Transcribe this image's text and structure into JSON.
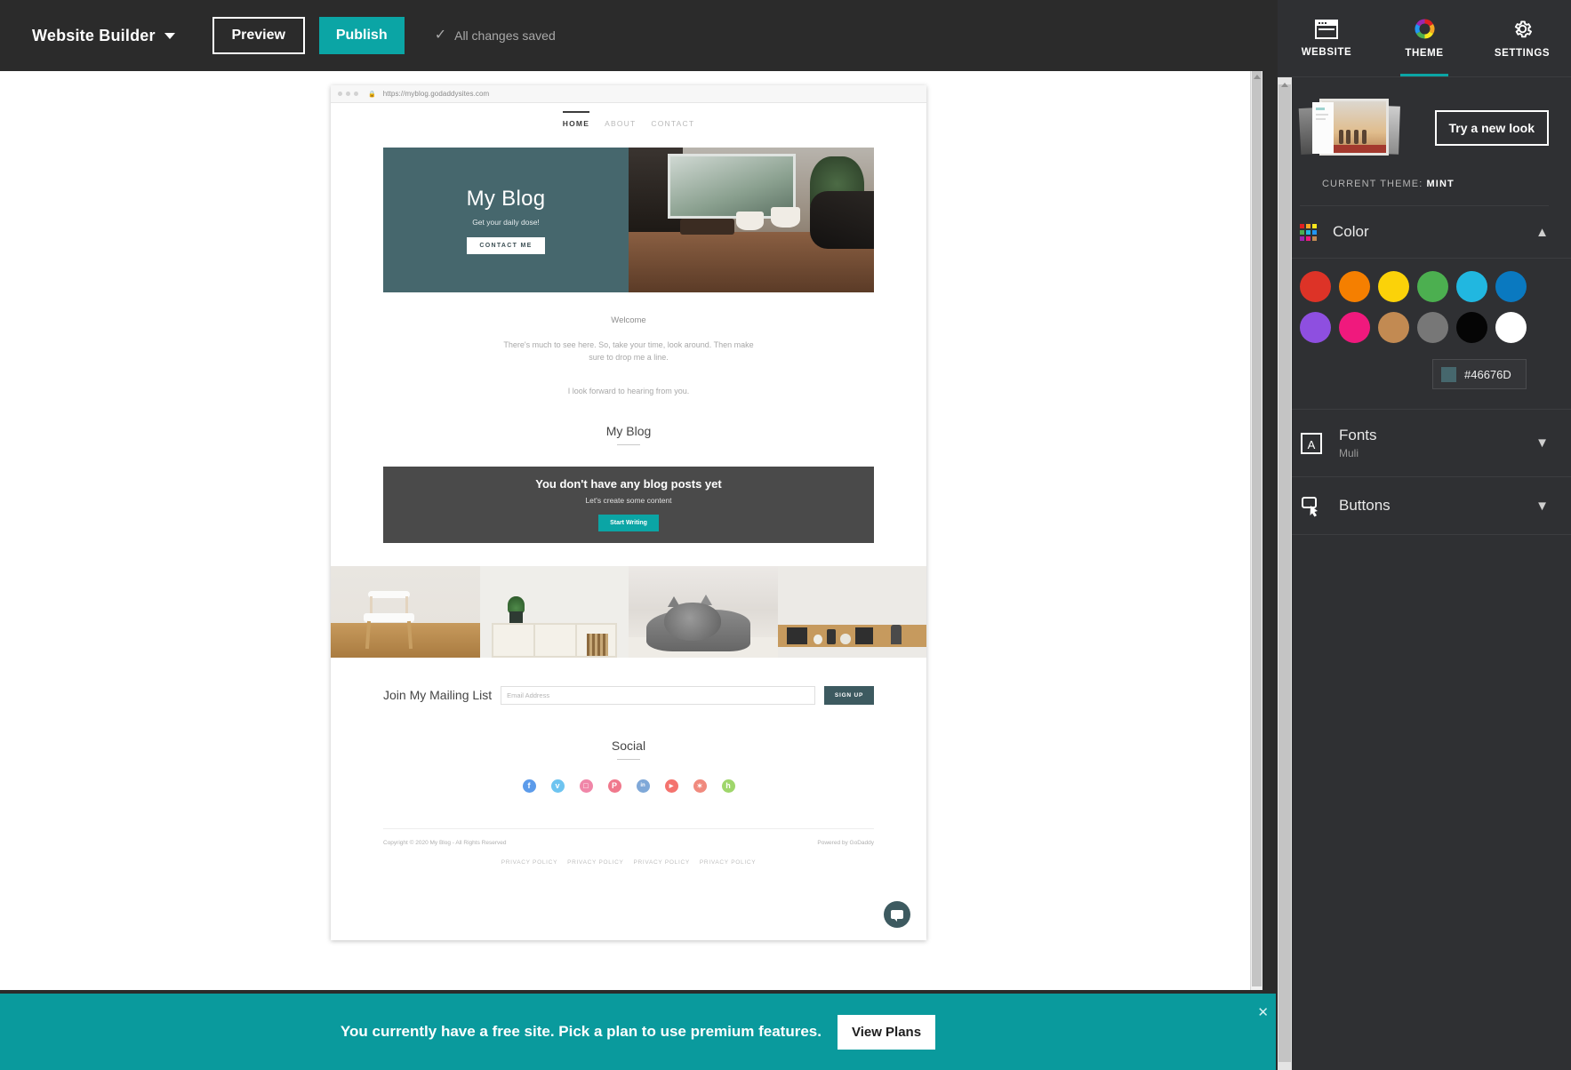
{
  "topbar": {
    "brand": "Website Builder",
    "brand_caret_icon": "chevron-down-icon",
    "preview_label": "Preview",
    "publish_label": "Publish",
    "saved_icon": "check-icon",
    "saved_label": "All changes saved",
    "publish_color": "#0ba5a5"
  },
  "panel": {
    "tabs": [
      {
        "label": "WEBSITE",
        "icon": "browser-window-icon",
        "active": false
      },
      {
        "label": "THEME",
        "icon": "color-wheel-icon",
        "active": true
      },
      {
        "label": "SETTINGS",
        "icon": "gear-icon",
        "active": false
      }
    ],
    "try_new_look_label": "Try a new look",
    "current_theme_prefix": "CURRENT THEME:",
    "current_theme_name": "MINT",
    "sections": [
      {
        "title": "Color",
        "icon": "color-palette-icon",
        "expanded": true,
        "chevron": "chevron-up-icon",
        "sub": ""
      },
      {
        "title": "Fonts",
        "icon": "font-letter-icon",
        "expanded": false,
        "chevron": "chevron-down-icon",
        "sub": "Muli"
      },
      {
        "title": "Buttons",
        "icon": "button-shape-icon",
        "expanded": false,
        "chevron": "chevron-down-icon",
        "sub": ""
      }
    ],
    "swatches_row1": [
      "#DD3327",
      "#F57F00",
      "#FBD209",
      "#4CAF50",
      "#21B7E0",
      "#0A79C0"
    ],
    "swatches_row2": [
      "#8E4FE0",
      "#F0197D",
      "#C28A52",
      "#777777",
      "#050505",
      "#FFFFFF"
    ],
    "selected_hex": "#46676D"
  },
  "site": {
    "browser": {
      "url": "https://myblog.godaddysites.com",
      "lock_icon": "lock-icon"
    },
    "nav": [
      {
        "label": "HOME",
        "active": true
      },
      {
        "label": "ABOUT",
        "active": false
      },
      {
        "label": "CONTACT",
        "active": false
      }
    ],
    "hero": {
      "title": "My Blog",
      "subtitle": "Get your daily dose!",
      "button": "CONTACT ME",
      "bg_color": "#46676D"
    },
    "welcome": {
      "title": "Welcome",
      "line1": "There's much to see here. So, take your time, look around. Then make",
      "line2": "sure to drop me a line.",
      "line3": "I look forward to hearing from you."
    },
    "blog": {
      "heading": "My Blog",
      "empty_title": "You don't have any blog posts yet",
      "empty_sub": "Let's create some content",
      "empty_button": "Start Writing"
    },
    "gallery": [
      {
        "name": "white-chair-on-wood-floor"
      },
      {
        "name": "shelf-with-plant-and-books"
      },
      {
        "name": "grey-kitten-on-couch"
      },
      {
        "name": "wooden-shelf-with-decor"
      }
    ],
    "mailing": {
      "label": "Join My Mailing List",
      "placeholder": "Email Address",
      "value": "",
      "button": "SIGN UP"
    },
    "social": {
      "heading": "Social",
      "icons": [
        {
          "name": "facebook-icon",
          "glyph": "f",
          "color": "#5C9BEA"
        },
        {
          "name": "twitter-icon",
          "glyph": "ᴠ",
          "color": "#6EC4F0"
        },
        {
          "name": "instagram-icon",
          "glyph": "□",
          "color": "#F086A8"
        },
        {
          "name": "pinterest-icon",
          "glyph": "P",
          "color": "#F0788C"
        },
        {
          "name": "linkedin-icon",
          "glyph": "in",
          "color": "#7FA8D8"
        },
        {
          "name": "youtube-icon",
          "glyph": "▶",
          "color": "#F4736E"
        },
        {
          "name": "yelp-icon",
          "glyph": "✶",
          "color": "#F08A7E"
        },
        {
          "name": "houzz-icon",
          "glyph": "h",
          "color": "#9FD66B"
        }
      ]
    },
    "footer": {
      "copyright": "Copyright © 2020 My Blog - All Rights Reserved",
      "powered": "Powered by GoDaddy",
      "links": [
        "PRIVACY POLICY",
        "PRIVACY POLICY",
        "PRIVACY POLICY",
        "PRIVACY POLICY"
      ]
    },
    "chat": {
      "icon": "chat-bubble-icon"
    }
  },
  "banner": {
    "text": "You currently have a free site. Pick a plan to use premium features.",
    "button": "View Plans",
    "close_icon": "close-icon",
    "close_glyph": "✕",
    "bg_color": "#0a9a9d"
  }
}
